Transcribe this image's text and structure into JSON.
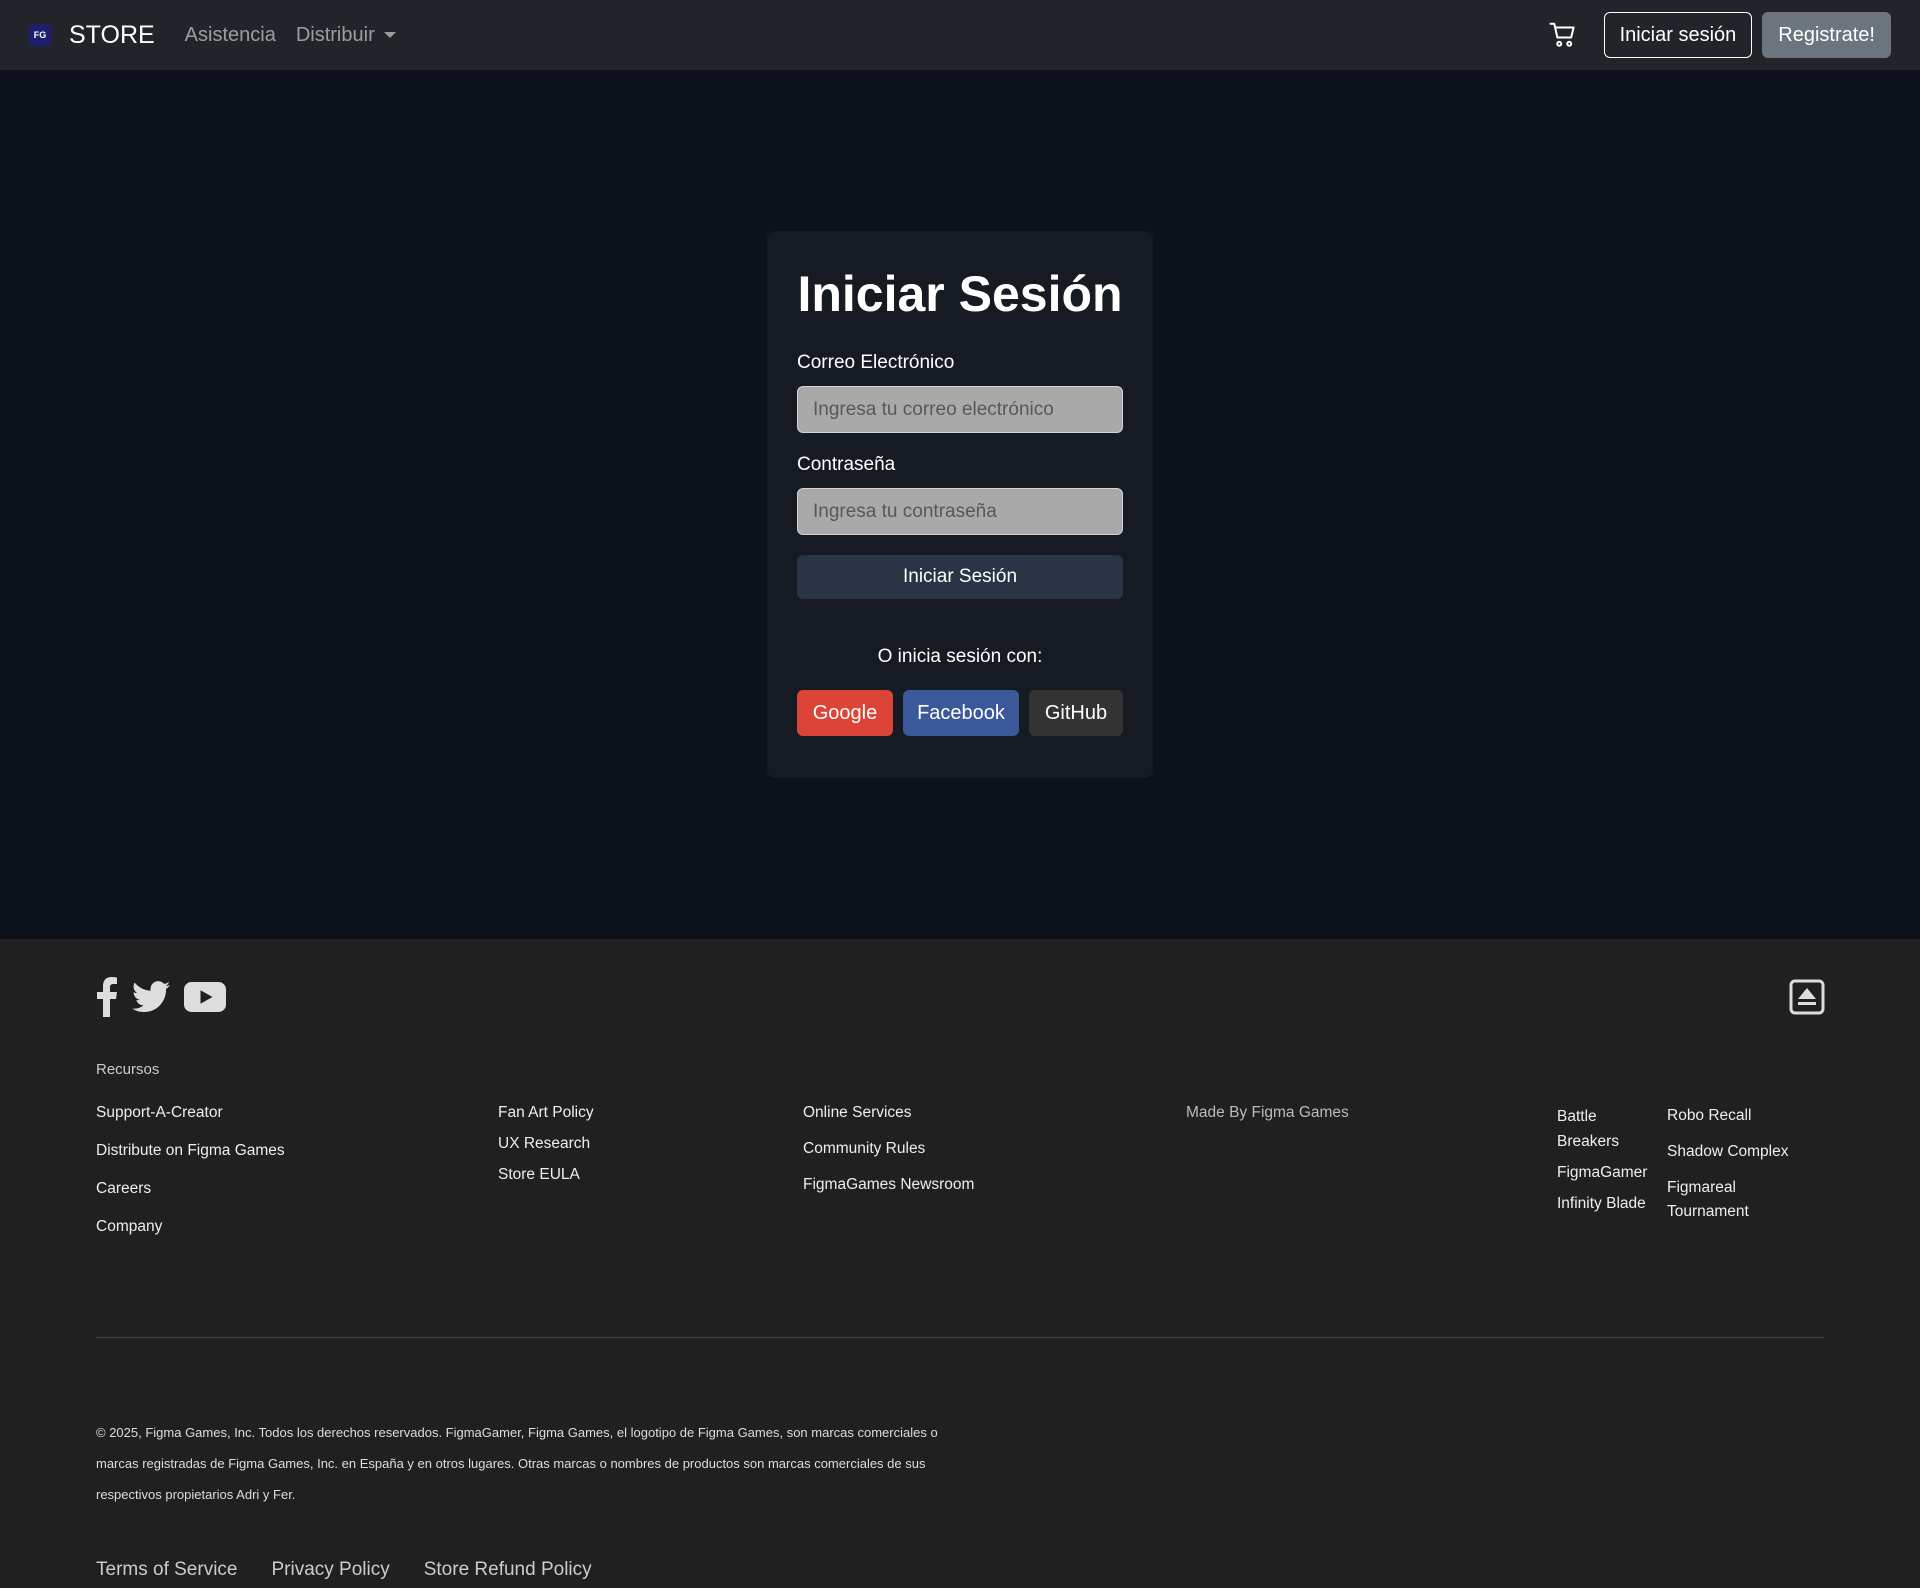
{
  "navbar": {
    "logo_text": "FG",
    "brand": "STORE",
    "links": [
      "Asistencia",
      "Distribuir"
    ],
    "login_label": "Iniciar sesión",
    "register_label": "Registrate!"
  },
  "login": {
    "title": "Iniciar Sesión",
    "email_label": "Correo Electrónico",
    "email_placeholder": "Ingresa tu correo electrónico",
    "password_label": "Contraseña",
    "password_placeholder": "Ingresa tu contraseña",
    "submit_label": "Iniciar Sesión",
    "or_text": "O inicia sesión con:",
    "social": [
      "Google",
      "Facebook",
      "GitHub"
    ],
    "colors": {
      "google": "#db4437",
      "facebook": "#3b5998",
      "github": "#333333"
    }
  },
  "footer": {
    "social_icons": [
      "facebook-icon",
      "twitter-icon",
      "youtube-icon"
    ],
    "back_to_top_icon": "arrow-up-box-icon",
    "resources_label": "Recursos",
    "col1": [
      "Support-A-Creator",
      "Distribute on Figma Games",
      "Careers",
      "Company"
    ],
    "col2": [
      "Fan Art Policy",
      "UX Research",
      "Store EULA"
    ],
    "col3": [
      "Online Services",
      "Community Rules",
      "FigmaGames Newsroom"
    ],
    "col4": [
      "Made By Figma Games"
    ],
    "col5": [
      "Battle Breakers",
      "FigmaGamer",
      "Infinity Blade"
    ],
    "col6": [
      "Robo Recall",
      "Shadow Complex",
      "Figmareal Tournament"
    ],
    "copyright": "© 2025, Figma Games, Inc. Todos los derechos reservados. FigmaGamer, Figma Games, el logotipo de Figma Games, son marcas comerciales o marcas registradas de Figma Games, Inc. en España y en otros lugares. Otras marcas o nombres de productos son marcas comerciales de sus respectivos propietarios Adri y Fer.",
    "legal": [
      "Terms of Service",
      "Privacy Policy",
      "Store Refund Policy"
    ]
  }
}
